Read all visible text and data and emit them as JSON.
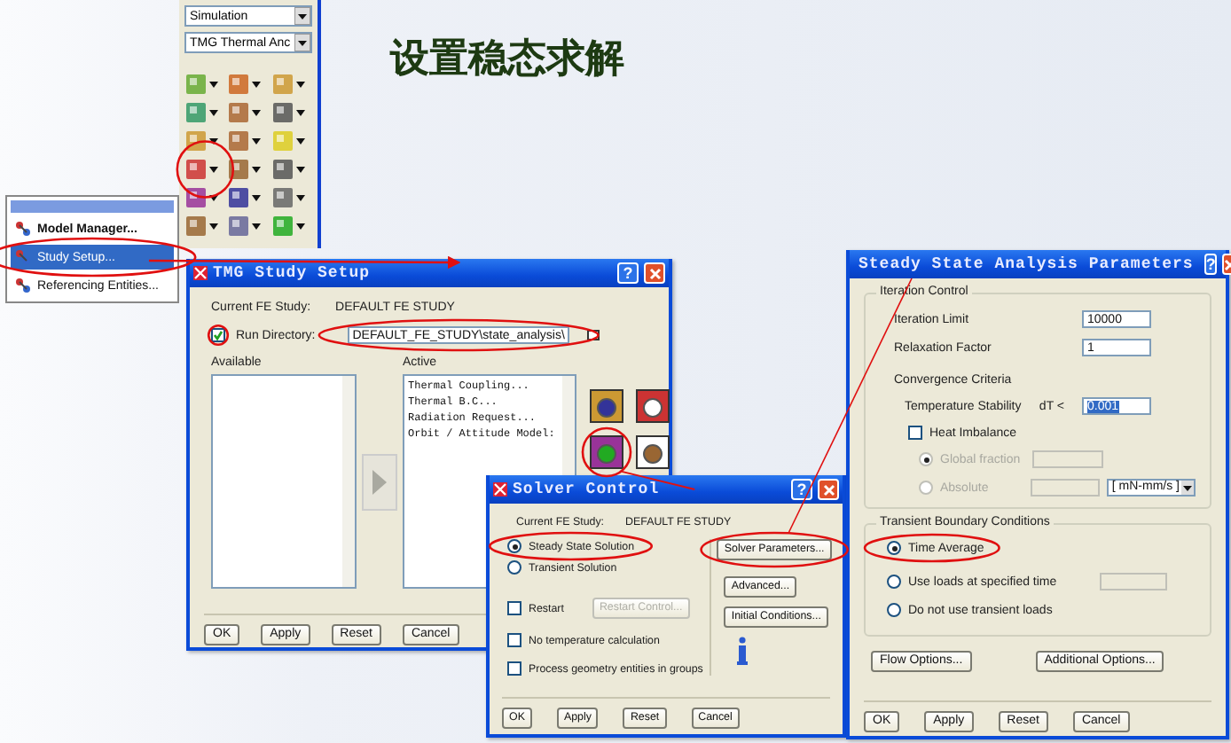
{
  "slide": {
    "title": "设置稳态求解"
  },
  "toolbar": {
    "dropdowns": [
      {
        "value": "Simulation"
      },
      {
        "value": "TMG Thermal Anc"
      }
    ]
  },
  "context_menu": {
    "items": [
      {
        "label": "Model Manager...",
        "selected": false
      },
      {
        "label": "Study Setup...",
        "selected": true
      },
      {
        "label": "Referencing Entities...",
        "selected": false
      }
    ]
  },
  "study_setup": {
    "title": "TMG Study Setup",
    "help": "?",
    "current_study_label": "Current FE Study:",
    "current_study": "DEFAULT FE STUDY",
    "run_directory": {
      "label": "Run Directory:",
      "checked": true,
      "value": "DEFAULT_FE_STUDY\\state_analysis\\"
    },
    "available_label": "Available",
    "active_label": "Active",
    "active_items": [
      "Thermal Coupling...",
      "Thermal B.C...",
      "Radiation Request...",
      "Orbit / Attitude Model:"
    ],
    "buttons": [
      "OK",
      "Apply",
      "Reset",
      "Cancel"
    ]
  },
  "solver_control": {
    "title": "Solver Control",
    "help": "?",
    "current_study_label": "Current FE Study:",
    "current_study": "DEFAULT FE STUDY",
    "solution_types": [
      {
        "label": "Steady State Solution",
        "selected": true
      },
      {
        "label": "Transient Solution",
        "selected": false
      }
    ],
    "restart": {
      "label": "Restart",
      "checked": false
    },
    "restart_control": {
      "label": "Restart Control...",
      "disabled": true
    },
    "options": [
      {
        "label": "No temperature calculation",
        "checked": false
      },
      {
        "label": "Process geometry entities in groups",
        "checked": false
      }
    ],
    "side_buttons": [
      "Solver Parameters...",
      "Advanced...",
      "Initial Conditions..."
    ],
    "buttons": [
      "OK",
      "Apply",
      "Reset",
      "Cancel"
    ]
  },
  "steady_state": {
    "title": "Steady State Analysis Parameters",
    "help": "?",
    "iteration_control": {
      "label": "Iteration Control",
      "fields": [
        {
          "label": "Iteration Limit",
          "value": "10000"
        },
        {
          "label": "Relaxation Factor",
          "value": "1"
        }
      ]
    },
    "convergence": {
      "label": "Convergence Criteria",
      "temperature_stability": {
        "label": "Temperature Stability",
        "symbol": "dT <",
        "value": "0.001",
        "highlighted": true
      },
      "heat_imbalance": {
        "label": "Heat Imbalance",
        "checked": false
      },
      "imbalance_modes": [
        {
          "label": "Global fraction",
          "selected": true,
          "disabled": true
        },
        {
          "label": "Absolute",
          "selected": false,
          "disabled": true
        }
      ],
      "unit": "[ mN-mm/s ]"
    },
    "transient": {
      "label": "Transient Boundary Conditions",
      "options": [
        {
          "label": "Time Average",
          "selected": true
        },
        {
          "label": "Use loads at specified time",
          "selected": false
        },
        {
          "label": "Do not use transient loads",
          "selected": false
        }
      ]
    },
    "option_buttons": [
      "Flow Options...",
      "Additional Options..."
    ],
    "buttons": [
      "OK",
      "Apply",
      "Reset",
      "Cancel"
    ]
  }
}
